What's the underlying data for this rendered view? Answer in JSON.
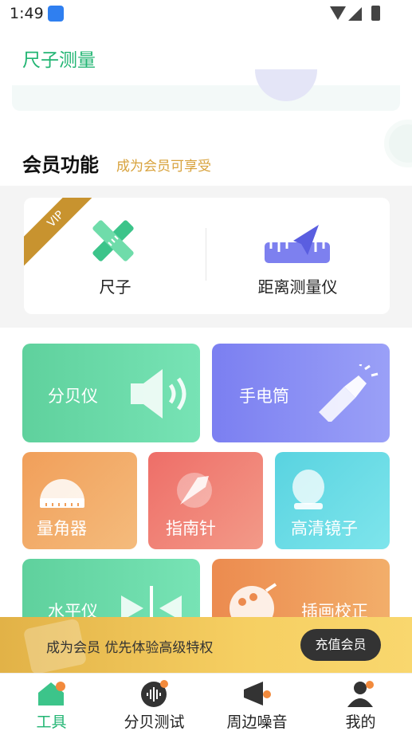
{
  "status_bar": {
    "time": "1:49"
  },
  "app": {
    "title": "尺子测量"
  },
  "member_section": {
    "title": "会员功能",
    "subtitle": "成为会员可享受"
  },
  "vip_card": {
    "ribbon": "VIP",
    "items": [
      {
        "label": "尺子",
        "icon": "ruler-icon"
      },
      {
        "label": "距离测量仪",
        "icon": "distance-meter-icon"
      }
    ]
  },
  "tools": [
    {
      "label": "分贝仪",
      "icon": "speaker-icon"
    },
    {
      "label": "手电筒",
      "icon": "flashlight-icon"
    },
    {
      "label": "量角器",
      "icon": "protractor-icon"
    },
    {
      "label": "指南针",
      "icon": "compass-icon"
    },
    {
      "label": "高清镜子",
      "icon": "mirror-icon"
    },
    {
      "label": "水平仪",
      "icon": "level-icon"
    },
    {
      "label": "插画校正",
      "icon": "palette-icon"
    }
  ],
  "banner": {
    "text": "成为会员 优先体验高级特权",
    "button": "充值会员"
  },
  "tabs": [
    {
      "label": "工具",
      "icon": "home-icon",
      "active": true
    },
    {
      "label": "分贝测试",
      "icon": "sound-wave-icon",
      "active": false
    },
    {
      "label": "周边噪音",
      "icon": "megaphone-icon",
      "active": false
    },
    {
      "label": "我的",
      "icon": "user-icon",
      "active": false
    }
  ],
  "colors": {
    "brand_green": "#22b573",
    "gold": "#d8a23c",
    "decibel_tile": "#5fd19d",
    "flashlight_tile": "#7b7ff1",
    "protractor_tile": "#f19f5a",
    "compass_tile": "#ee6e68",
    "mirror_tile": "#59d3e0",
    "paint_tile": "#ec8b4f"
  }
}
